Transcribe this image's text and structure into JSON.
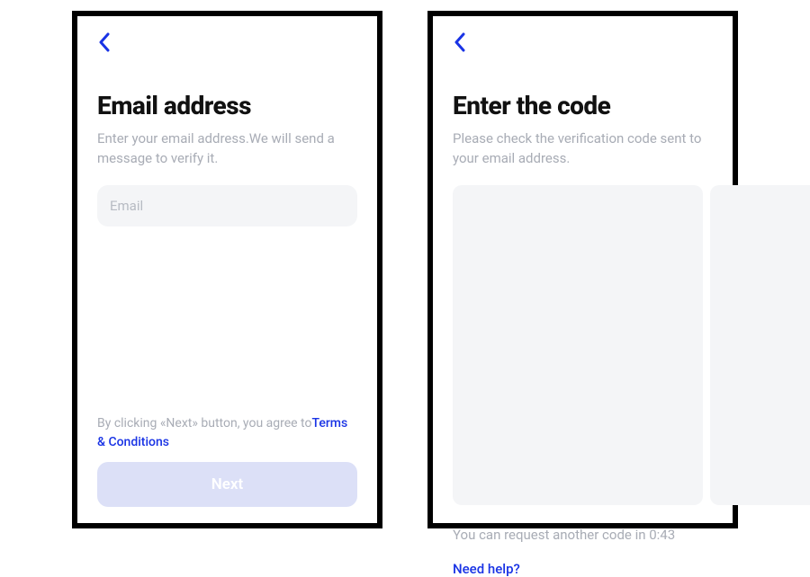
{
  "colors": {
    "accent": "#1933e5",
    "muted": "#a8acb5",
    "field": "#f4f5f7",
    "btn_disabled": "#dce0f7"
  },
  "screen_email": {
    "title": "Email address",
    "description": "Enter your email address.We will send a message to verify it.",
    "email_placeholder": "Email",
    "email_value": "",
    "agree_prefix": "By clicking «Next» button, you agree to",
    "terms_label": "Terms & Conditions",
    "next_label": "Next"
  },
  "screen_code": {
    "title": "Enter the code",
    "description": "Please check the verification code sent to your email address.",
    "digits": [
      "",
      "",
      "",
      "",
      "",
      ""
    ],
    "resend_prefix": "You can request another code in ",
    "resend_countdown": "0:43",
    "help_label": "Need help?"
  }
}
